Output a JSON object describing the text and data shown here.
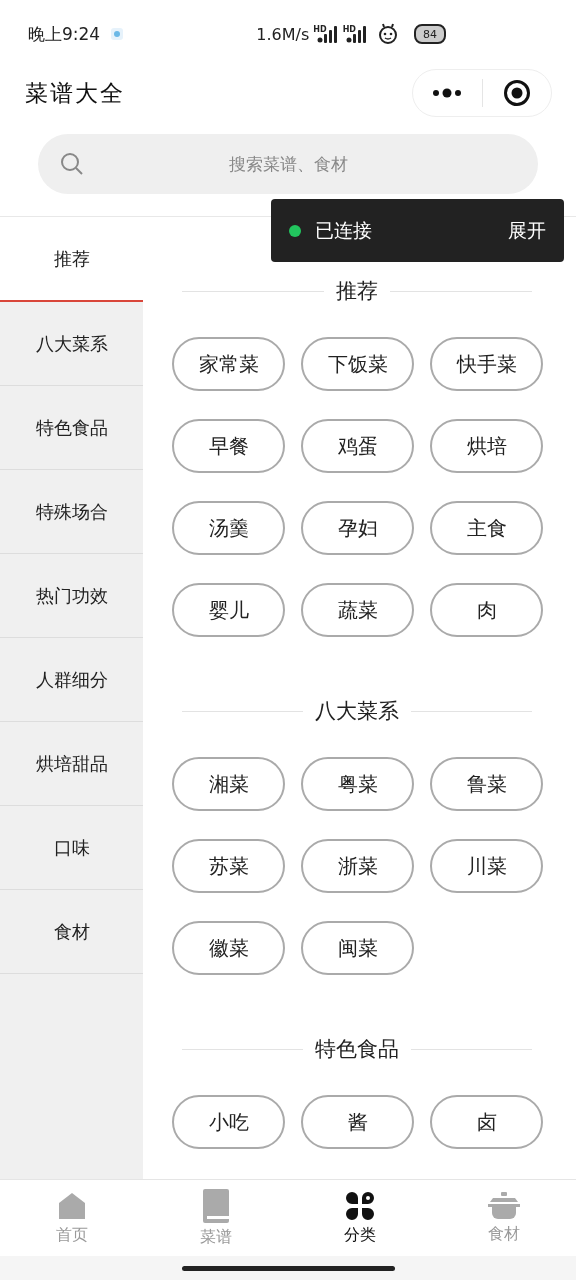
{
  "status_bar": {
    "time": "晚上9:24",
    "speed": "1.6M/s",
    "signal_labels": [
      "HD",
      "HD"
    ],
    "battery": "84"
  },
  "header": {
    "title": "菜谱大全"
  },
  "search": {
    "placeholder": "搜索菜谱、食材"
  },
  "toast": {
    "status": "已连接",
    "action": "展开",
    "color": "#22c55e"
  },
  "sidebar": {
    "items": [
      {
        "label": "推荐",
        "selected": true
      },
      {
        "label": "八大菜系",
        "selected": false
      },
      {
        "label": "特色食品",
        "selected": false
      },
      {
        "label": "特殊场合",
        "selected": false
      },
      {
        "label": "热门功效",
        "selected": false
      },
      {
        "label": "人群细分",
        "selected": false
      },
      {
        "label": "烘培甜品",
        "selected": false
      },
      {
        "label": "口味",
        "selected": false
      },
      {
        "label": "食材",
        "selected": false
      }
    ]
  },
  "sections": [
    {
      "title": "推荐",
      "tags": [
        "家常菜",
        "下饭菜",
        "快手菜",
        "早餐",
        "鸡蛋",
        "烘培",
        "汤羹",
        "孕妇",
        "主食",
        "婴儿",
        "蔬菜",
        "肉"
      ]
    },
    {
      "title": "八大菜系",
      "tags": [
        "湘菜",
        "粤菜",
        "鲁菜",
        "苏菜",
        "浙菜",
        "川菜",
        "徽菜",
        "闽菜"
      ]
    },
    {
      "title": "特色食品",
      "tags": [
        "小吃",
        "酱",
        "卤"
      ]
    }
  ],
  "tab_bar": [
    {
      "label": "首页",
      "kind": "home",
      "selected": false
    },
    {
      "label": "菜谱",
      "kind": "book",
      "selected": false
    },
    {
      "label": "分类",
      "kind": "category",
      "selected": true
    },
    {
      "label": "食材",
      "kind": "pot",
      "selected": false
    }
  ]
}
